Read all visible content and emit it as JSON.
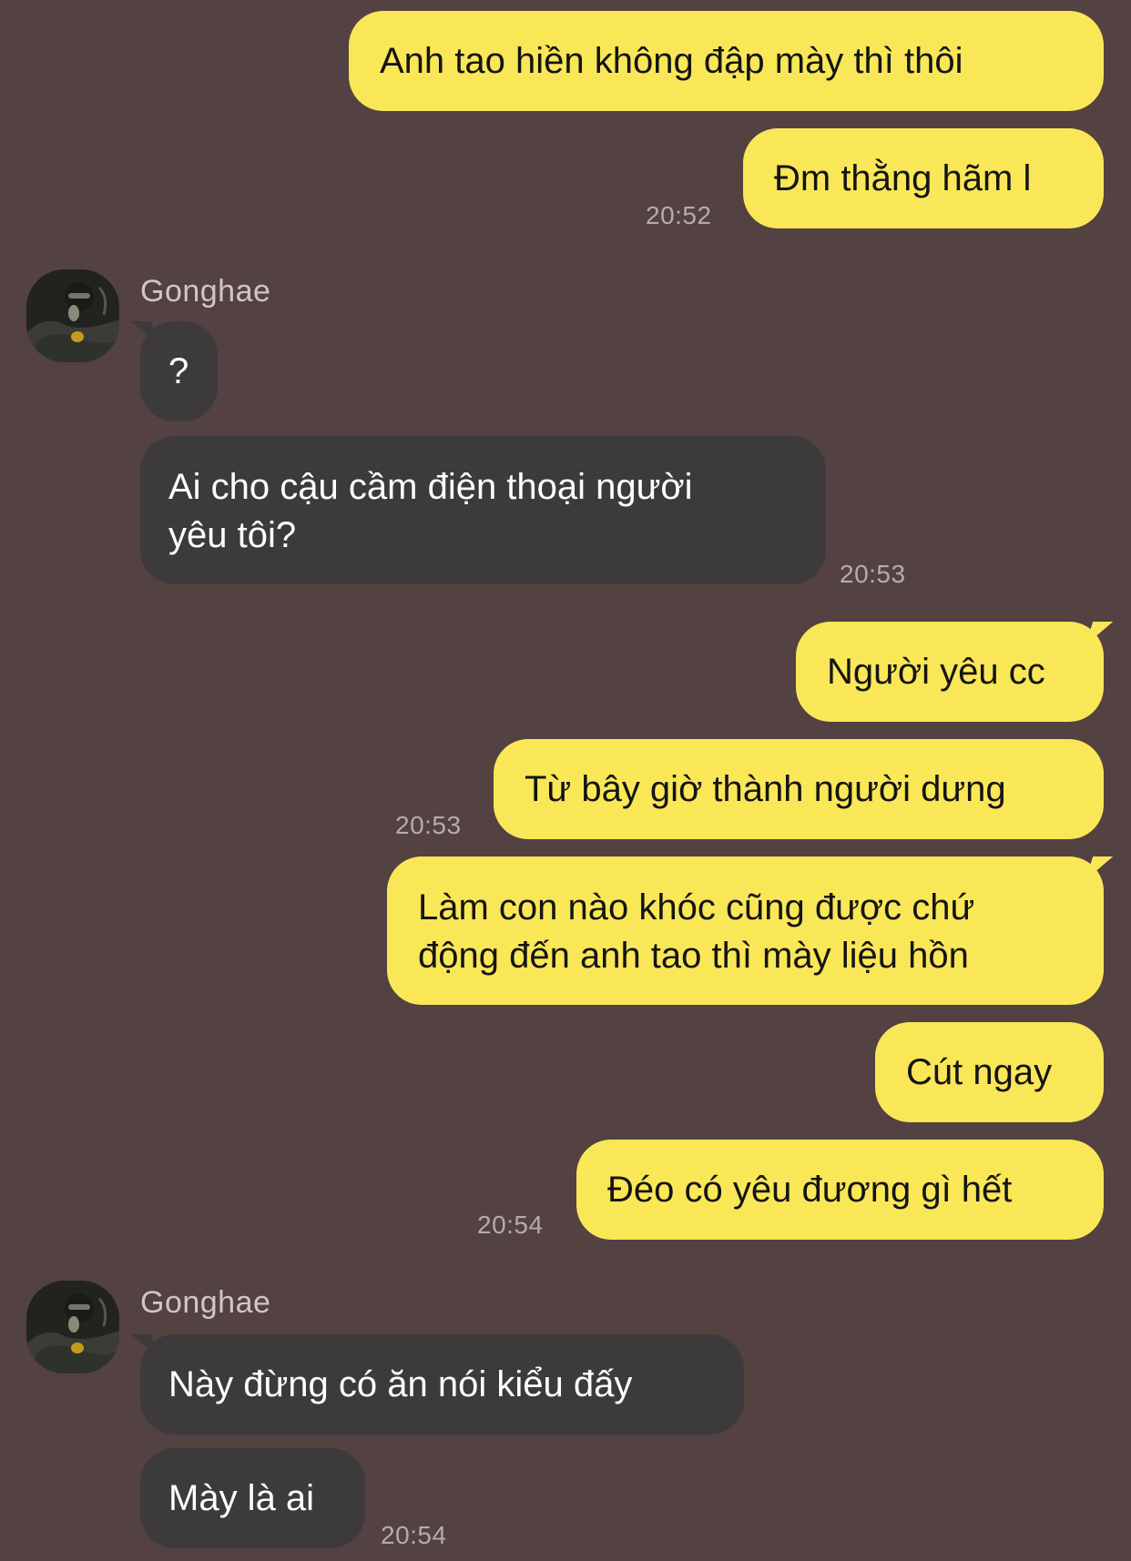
{
  "colors": {
    "background": "#544142",
    "outgoing_bubble": "#fae757",
    "incoming_bubble": "#3d3a3c",
    "timestamp": "#b5abab"
  },
  "messages": {
    "m1": "Anh tao hiền không đập mày thì thôi",
    "m2": "Đm thằng hãm l",
    "t1": "20:52",
    "sender1": "Gonghae",
    "m3": "?",
    "m4_line1": "Ai cho cậu cầm điện thoại người",
    "m4_line2": "yêu tôi?",
    "t2": "20:53",
    "m5": "Người yêu cc",
    "m6": "Từ bây giờ thành người dưng",
    "t3": "20:53",
    "m7_line1": "Làm con nào khóc cũng được chứ",
    "m7_line2": "động đến anh tao thì mày liệu hồn",
    "m8": "Cút ngay",
    "m9": "Đéo có yêu đương gì hết",
    "t4": "20:54",
    "sender2": "Gonghae",
    "m10": "Này đừng có ăn nói kiểu đấy",
    "m11": "Mày là ai",
    "t5": "20:54"
  }
}
